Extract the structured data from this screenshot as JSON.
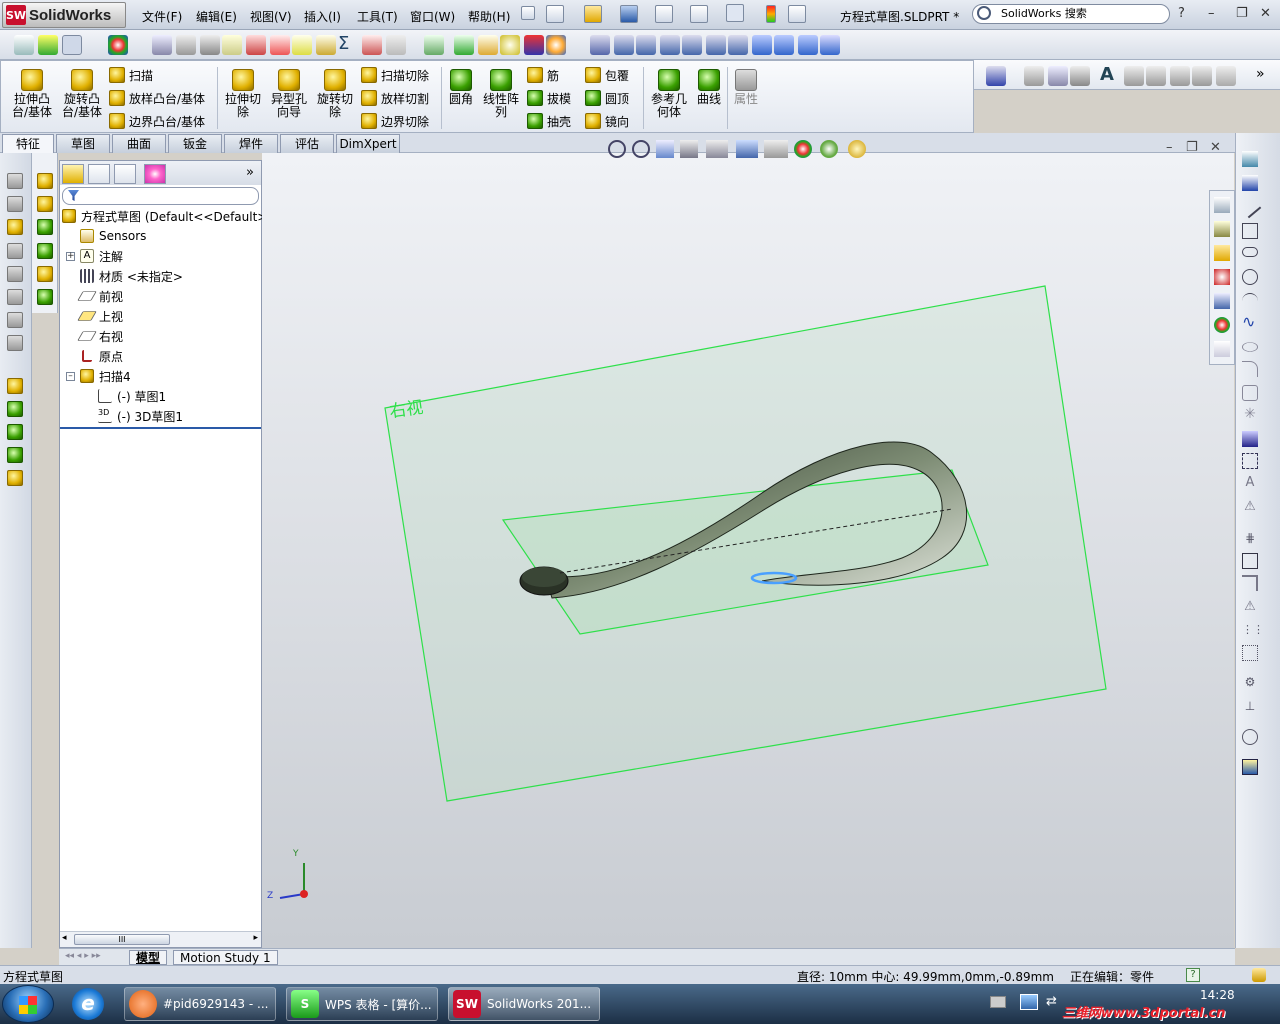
{
  "app": {
    "logo_text": "SolidWorks",
    "doc_title": "方程式草图.SLDPRT *",
    "search_placeholder": "SolidWorks 搜索"
  },
  "menus": [
    "文件(F)",
    "编辑(E)",
    "视图(V)",
    "插入(I)",
    "工具(T)",
    "窗口(W)",
    "帮助(H)"
  ],
  "commandmanager": {
    "big": [
      {
        "label": "拉伸凸\n台/基体",
        "icon": "extrude-boss-icon"
      },
      {
        "label": "旋转凸\n台/基体",
        "icon": "revolve-boss-icon"
      },
      {
        "label": "拉伸切\n除",
        "icon": "extrude-cut-icon"
      },
      {
        "label": "异型孔\n向导",
        "icon": "hole-wizard-icon"
      },
      {
        "label": "旋转切\n除",
        "icon": "revolve-cut-icon"
      },
      {
        "label": "圆角",
        "icon": "fillet-icon"
      },
      {
        "label": "线性阵\n列",
        "icon": "linear-pattern-icon"
      },
      {
        "label": "参考几\n何体",
        "icon": "ref-geometry-icon"
      },
      {
        "label": "曲线",
        "icon": "curves-icon"
      },
      {
        "label": "属性",
        "icon": "properties-icon"
      }
    ],
    "small": {
      "sweep": "扫描",
      "loft": "放样凸台/基体",
      "boundary": "边界凸台/基体",
      "sweep_cut": "扫描切除",
      "loft_cut": "放样切割",
      "boundary_cut": "边界切除",
      "rib": "筋",
      "draft": "拔模",
      "shell": "抽壳",
      "wrap": "包覆",
      "dome": "圆顶",
      "mirror": "镜向"
    }
  },
  "tabs": [
    "特征",
    "草图",
    "曲面",
    "钣金",
    "焊件",
    "评估",
    "DimXpert"
  ],
  "active_tab": "特征",
  "tree": {
    "root": "方程式草图  (Default<<Default>",
    "items": [
      {
        "label": "Sensors",
        "icon": "sensors-icon"
      },
      {
        "label": "注解",
        "icon": "annotations-icon"
      },
      {
        "label": "材质 <未指定>",
        "icon": "material-icon"
      },
      {
        "label": "前视",
        "icon": "plane-icon"
      },
      {
        "label": "上视",
        "icon": "plane-icon"
      },
      {
        "label": "右视",
        "icon": "plane-icon"
      },
      {
        "label": "原点",
        "icon": "origin-icon"
      },
      {
        "label": "扫描4",
        "icon": "sweep-icon"
      }
    ],
    "children": [
      {
        "label": "(-) 草图1",
        "icon": "sketch-icon"
      },
      {
        "label": "(-) 3D草图1",
        "icon": "3dsketch-icon"
      }
    ]
  },
  "viewport": {
    "plane_label": "右视",
    "axis_labels": {
      "y": "Y",
      "z": "Z"
    }
  },
  "bottom_tabs": [
    "模型",
    "Motion Study 1"
  ],
  "status": {
    "left": "方程式草图",
    "measure": "直径: 10mm  中心: 49.99mm,0mm,-0.89mm",
    "editing": "正在编辑：零件",
    "help": "?"
  },
  "taskbar": {
    "apps": [
      {
        "label": "#pid6929143 - ...",
        "icon": "browser-icon"
      },
      {
        "label": "WPS 表格 - [算价...",
        "icon": "wps-icon"
      },
      {
        "label": "SolidWorks 201...",
        "icon": "solidworks-icon"
      }
    ],
    "clock": "14:28",
    "watermark": "三维网www.3dportal.cn"
  },
  "colors": {
    "plane_green": "#2ee04a",
    "brand_red": "#c8102e",
    "part_dark": "#3f4a3a"
  }
}
